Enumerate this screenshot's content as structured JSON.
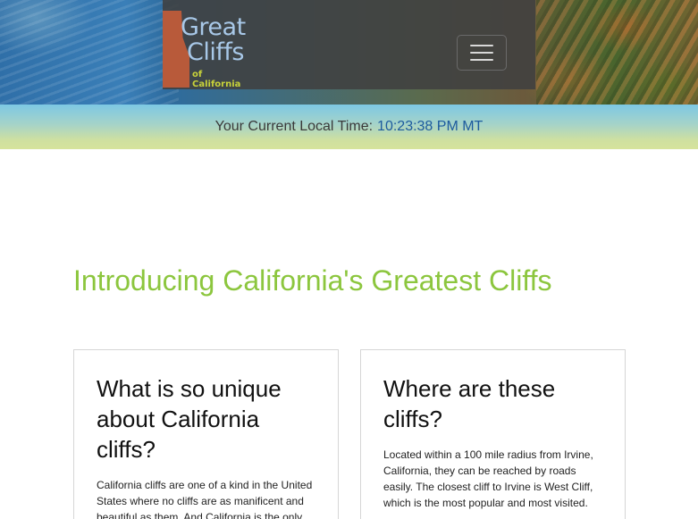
{
  "header": {
    "logo": {
      "line1": "Great",
      "line2": "Cliffs",
      "line3": "of California"
    },
    "menu_toggle": "hamburger-icon"
  },
  "timebar": {
    "label": "Your Current Local Time:",
    "value": "10:23:38 PM MT"
  },
  "intro": {
    "title": "Introducing California's Greatest Cliffs"
  },
  "cards": [
    {
      "heading": "What is so unique about California cliffs?",
      "body": "California cliffs are one of a kind in the United States where no cliffs are as manificent and beautiful as them. And California is the only"
    },
    {
      "heading": "Where are these cliffs?",
      "body": "Located within a 100 mile radius from Irvine, California, they can be reached by roads easily. The closest cliff to Irvine is West Cliff, which is the most popular and most visited."
    }
  ],
  "colors": {
    "accent_green": "#8cc63e",
    "time_blue": "#1d5b9e",
    "logo_blue": "#a8c8e8",
    "logo_red": "#b85a3a"
  }
}
